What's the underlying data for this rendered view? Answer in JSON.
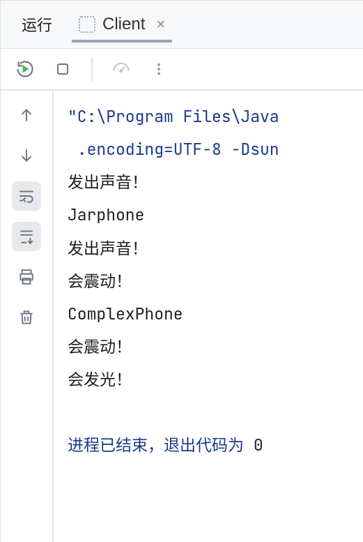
{
  "tabs": {
    "panel_label": "运行",
    "active_tab": "Client"
  },
  "console": {
    "cmd_line1": "\"C:\\Program Files\\Java",
    "cmd_line2": " .encoding=UTF-8 -Dsun",
    "output_lines": [
      "发出声音！",
      "Jarphone",
      "发出声音！",
      "会震动！",
      "ComplexPhone",
      "会震动！",
      "会发光！"
    ],
    "exit_prefix": "进程已结束，退出代码为 ",
    "exit_code": "0"
  }
}
